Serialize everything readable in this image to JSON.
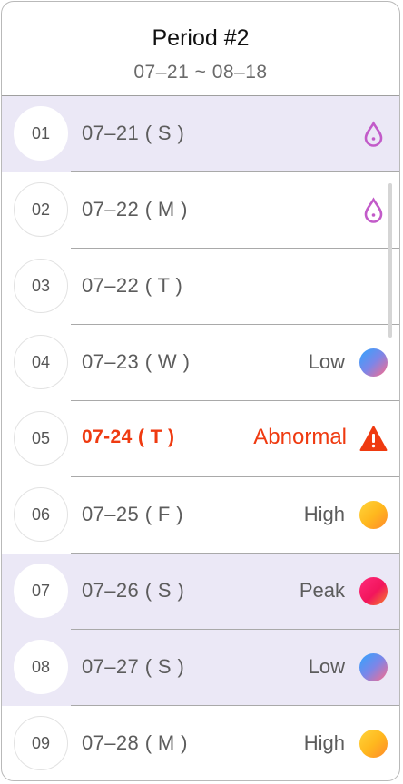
{
  "header": {
    "title": "Period #2",
    "range": "07–21 ~ 08–18"
  },
  "rows": [
    {
      "num": "01",
      "date": "07–21 ( S )",
      "status": "",
      "indicator": "drop-icon",
      "highlight": true
    },
    {
      "num": "02",
      "date": "07–22 ( M )",
      "status": "",
      "indicator": "drop-icon",
      "highlight": false
    },
    {
      "num": "03",
      "date": "07–22 ( T )",
      "status": "",
      "indicator": "",
      "highlight": false
    },
    {
      "num": "04",
      "date": "07–23 ( W )",
      "status": "Low",
      "indicator": "low-dot-icon",
      "highlight": false
    },
    {
      "num": "05",
      "date": "07-24 ( T )",
      "status": "Abnormal",
      "indicator": "warning-icon",
      "highlight": false
    },
    {
      "num": "06",
      "date": "07–25 ( F )",
      "status": "High",
      "indicator": "high-dot-icon",
      "highlight": false
    },
    {
      "num": "07",
      "date": "07–26 ( S )",
      "status": "Peak",
      "indicator": "peak-dot-icon",
      "highlight": true
    },
    {
      "num": "08",
      "date": "07–27 ( S )",
      "status": "Low",
      "indicator": "low-dot-icon",
      "highlight": true
    },
    {
      "num": "09",
      "date": "07–28 ( M )",
      "status": "High",
      "indicator": "high-dot-icon",
      "highlight": false
    }
  ],
  "colors": {
    "accent": "#c25bc9",
    "abnormal": "#ef3a10",
    "highlight": "#ebe8f6"
  }
}
